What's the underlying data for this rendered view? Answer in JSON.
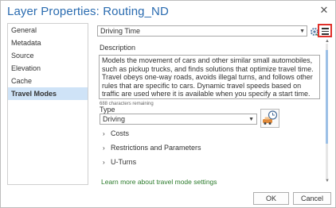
{
  "window": {
    "title": "Layer Properties: Routing_ND",
    "close_glyph": "✕"
  },
  "nav": {
    "items": [
      {
        "label": "General",
        "active": false
      },
      {
        "label": "Metadata",
        "active": false
      },
      {
        "label": "Source",
        "active": false
      },
      {
        "label": "Elevation",
        "active": false
      },
      {
        "label": "Cache",
        "active": false
      },
      {
        "label": "Travel Modes",
        "active": true
      }
    ]
  },
  "travel_mode": {
    "selected": "Driving Time",
    "description_label": "Description",
    "description": "Models the movement of cars and other similar small automobiles, such as pickup trucks, and finds solutions that optimize travel time. Travel obeys one-way roads, avoids illegal turns, and follows other rules that are specific to cars. Dynamic travel speeds based on traffic are used where it is available when you specify a start time.",
    "remaining": "688 characters remaining",
    "type_label": "Type",
    "type_value": "Driving",
    "sections": [
      "Costs",
      "Restrictions and Parameters",
      "U-Turns"
    ],
    "learn_more": "Learn more about travel mode settings"
  },
  "buttons": {
    "ok": "OK",
    "cancel": "Cancel"
  },
  "colors": {
    "title": "#2b6cb0",
    "highlight_box": "#e0302a",
    "nav_active": "#cfe3f7",
    "link": "#2a7a2a"
  },
  "icons": {
    "gear": "gear-icon",
    "menu": "hamburger-menu-icon",
    "type": "car-clock-icon",
    "chevron": "chevron-right-icon"
  }
}
